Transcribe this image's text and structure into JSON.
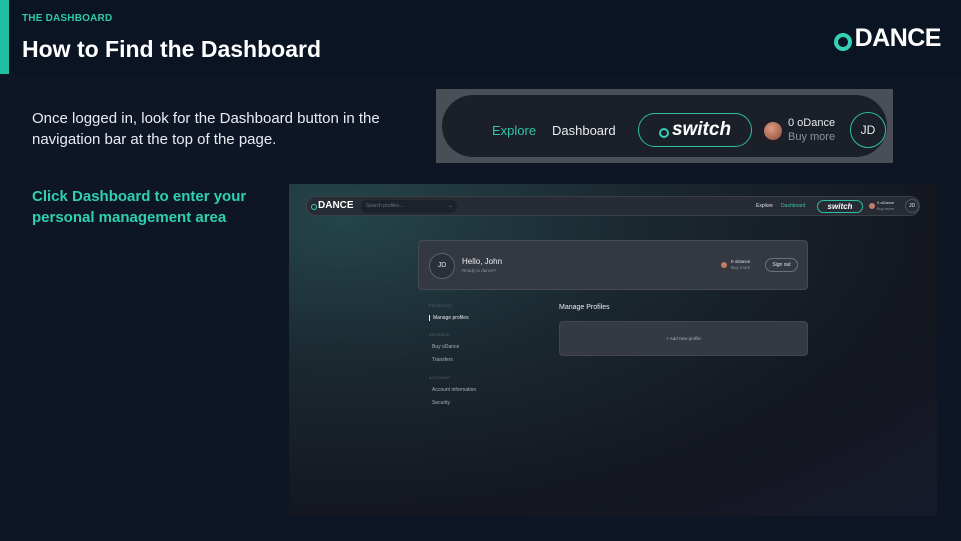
{
  "slide": {
    "kicker": "THE DASHBOARD",
    "title": "How to Find the Dashboard",
    "brand": "DANCE",
    "intro": "Once logged in, look for the Dashboard button in the navigation bar at the top of the page.",
    "callout": "Click Dashboard to enter your personal management area",
    "colors": {
      "accent": "#1fbfa3",
      "background": "#0e1626",
      "header": "#0a1423"
    }
  },
  "nav_crop": {
    "explore": "Explore",
    "dashboard": "Dashboard",
    "switch": "switch",
    "balance": "0 oDance",
    "buy_more": "Buy more",
    "avatar": "JD"
  },
  "app": {
    "logo": "DANCE",
    "search_placeholder": "Search profiles...",
    "nav": {
      "explore": "Explore",
      "dashboard": "Dashboard",
      "switch": "switch",
      "balance": "0 oDance",
      "buy_more": "Buy more",
      "avatar": "JD"
    },
    "profile": {
      "avatar": "JD",
      "greeting": "Hello, John",
      "subtitle": "Ready to dance?",
      "balance": "0 oDance",
      "buy_more": "Buy more",
      "sign_out": "Sign out"
    },
    "sidebar": {
      "sections": [
        {
          "label": "PROFILES",
          "items": [
            "Manage profiles"
          ]
        },
        {
          "label": "ADVANCE",
          "items": [
            "Buy oDance",
            "Transfers"
          ]
        },
        {
          "label": "ACCOUNT",
          "items": [
            "Account information",
            "Security"
          ]
        }
      ]
    },
    "main": {
      "title": "Manage Profiles",
      "add_new": "+ Add new profile"
    }
  }
}
